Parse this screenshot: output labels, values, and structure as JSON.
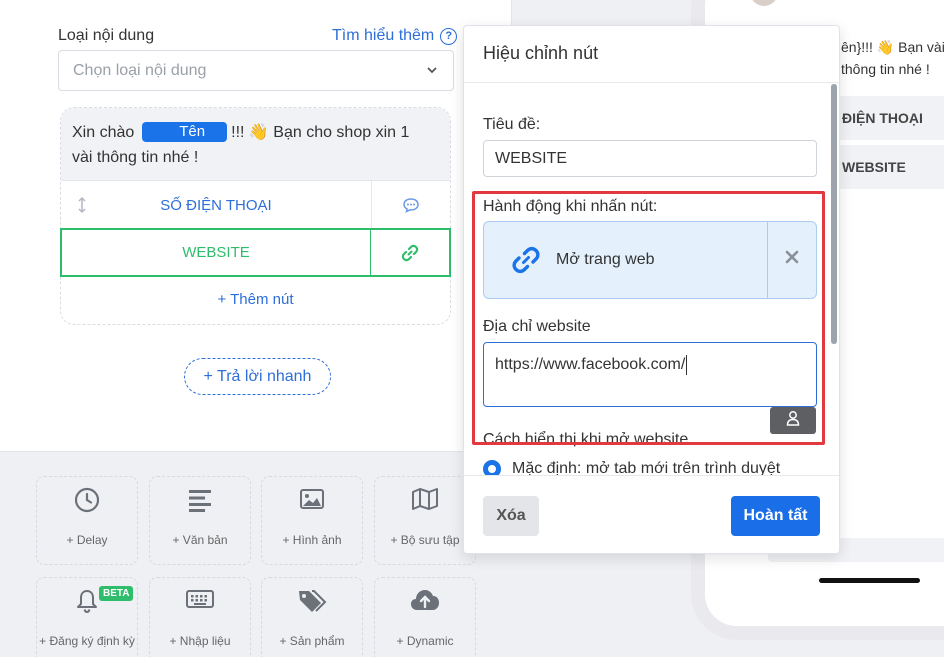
{
  "editor": {
    "content_type_label": "Loại nội dung",
    "learn_more": "Tìm hiểu thêm",
    "content_type_placeholder": "Chọn loại nội dung",
    "message_prefix": "Xin chào",
    "name_tag": "Tên",
    "message_suffix": "!!! 👋 Bạn cho shop xin 1 vài thông tin nhé !",
    "buttons": [
      {
        "label": "SỐ ĐIỆN THOẠI",
        "icon": "chat-bubble-icon"
      },
      {
        "label": "WEBSITE",
        "icon": "link-icon",
        "color": "#2ebd6b"
      }
    ],
    "add_button": "+ Thêm nút",
    "quick_reply": "+ Trả lời nhanh"
  },
  "tools": [
    {
      "label": "+ Delay",
      "icon": "clock-icon"
    },
    {
      "label": "+ Văn bản",
      "icon": "text-lines-icon"
    },
    {
      "label": "+ Hình ảnh",
      "icon": "image-icon"
    },
    {
      "label": "+ Bộ sưu tập",
      "icon": "map-icon"
    },
    {
      "label": "+ Đăng ký định kỳ",
      "icon": "bell-icon",
      "badge": "BETA"
    },
    {
      "label": "+ Nhập liệu",
      "icon": "keyboard-icon"
    },
    {
      "label": "+ Sản phẩm",
      "icon": "tags-icon"
    },
    {
      "label": "+ Dynamic",
      "icon": "cloud-upload-icon"
    }
  ],
  "preview": {
    "message_partial": "ên}!!! 👋 Bạn vài thông tin nhé !",
    "buttons": [
      "ĐIỆN THOẠI",
      "WEBSITE"
    ]
  },
  "modal": {
    "title": "Hiệu chỉnh nút",
    "title_field_label": "Tiêu đề:",
    "title_value": "WEBSITE",
    "action_label": "Hành động khi nhấn nút:",
    "action_value": "Mở trang web",
    "url_label": "Địa chỉ website",
    "url_value": "https://www.facebook.com/",
    "display_label": "Cách hiển thị khi mở website",
    "display_option": "Mặc định: mở tab mới trên trình duyệt",
    "delete_button": "Xóa",
    "done_button": "Hoàn tất"
  },
  "colors": {
    "accent": "#1a73e8",
    "success": "#2ebd6b",
    "highlight": "#e0393e"
  }
}
